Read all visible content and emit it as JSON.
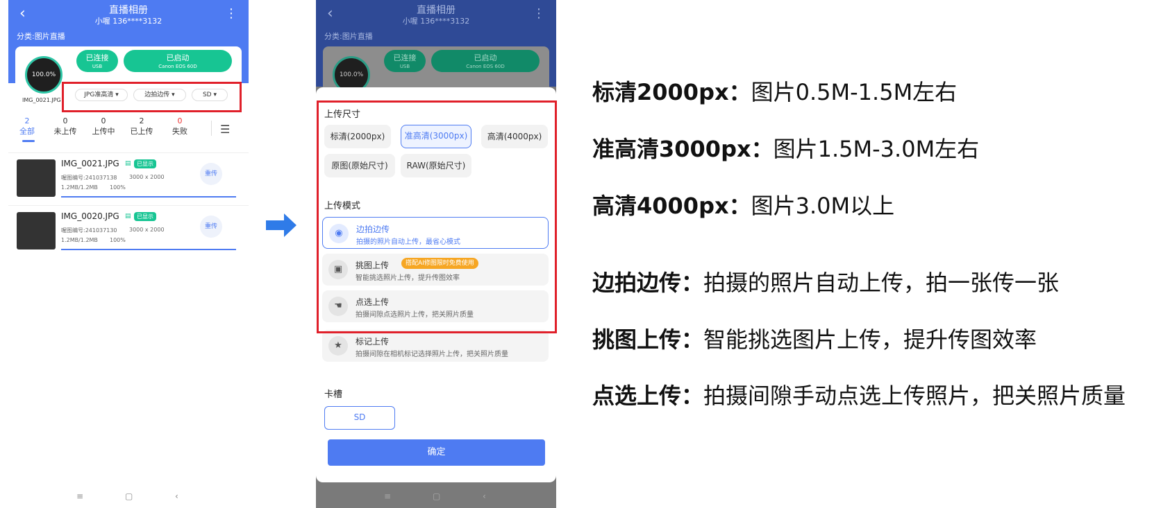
{
  "phone1": {
    "title": "直播相册",
    "subtitle": "小喔 136****3132",
    "category": "分类:图片直播",
    "progress_text": "100.0%",
    "current_file": "IMG_0021.JPG",
    "connect_l1": "已连接",
    "connect_l2": "USB",
    "start_l1": "已启动",
    "start_l2": "Canon EOS 60D",
    "dd_size": "JPG准高清",
    "dd_mode": "边拍边传",
    "dd_slot": "SD",
    "tabs": [
      {
        "num": "2",
        "label": "全部"
      },
      {
        "num": "0",
        "label": "未上传"
      },
      {
        "num": "0",
        "label": "上传中"
      },
      {
        "num": "2",
        "label": "已上传"
      },
      {
        "num": "0",
        "label": "失败"
      }
    ],
    "rows": [
      {
        "name": "IMG_0021.JPG",
        "badge": "已显示",
        "id": "喔图编号:241037138",
        "res": "3000 x 2000",
        "size": "1.2MB/1.2MB",
        "pct": "100%",
        "btn": "重传"
      },
      {
        "name": "IMG_0020.JPG",
        "badge": "已显示",
        "id": "喔图编号:241037130",
        "res": "3000 x 2000",
        "size": "1.2MB/1.2MB",
        "pct": "100%",
        "btn": "重传"
      }
    ]
  },
  "phone2": {
    "size_title": "上传尺寸",
    "sizes": [
      "标清(2000px)",
      "准高清(3000px)",
      "高清(4000px)",
      "原图(原始尺寸)",
      "RAW(原始尺寸)"
    ],
    "mode_title": "上传模式",
    "modes": [
      {
        "title": "边拍边传",
        "desc": "拍摄的照片自动上传，最省心模式"
      },
      {
        "title": "挑图上传",
        "desc": "智能挑选照片上传，提升传图效率",
        "badge": "搭配AI修图限时免费使用"
      },
      {
        "title": "点选上传",
        "desc": "拍摄间隙点选照片上传，把关照片质量"
      },
      {
        "title": "标记上传",
        "desc": "拍摄间隙在相机标记选择照片上传，把关照片质量"
      }
    ],
    "slot_title": "卡槽",
    "slot_value": "SD",
    "confirm": "确定"
  },
  "notes": [
    {
      "bold": "标清2000px：",
      "text": "图片0.5M-1.5M左右"
    },
    {
      "bold": "准高清3000px：",
      "text": "图片1.5M-3.0M左右"
    },
    {
      "bold": "高清4000px：",
      "text": "图片3.0M以上"
    },
    {
      "bold": "边拍边传：",
      "text": "拍摄的照片自动上传，拍一张传一张"
    },
    {
      "bold": "挑图上传：",
      "text": "智能挑选图片上传，提升传图效率"
    },
    {
      "bold": "点选上传：",
      "text": "拍摄间隙手动点选上传照片，把关照片质量"
    }
  ],
  "colors": {
    "accent": "#4e7bf2",
    "green": "#17c593",
    "highlight": "#e0202a"
  }
}
